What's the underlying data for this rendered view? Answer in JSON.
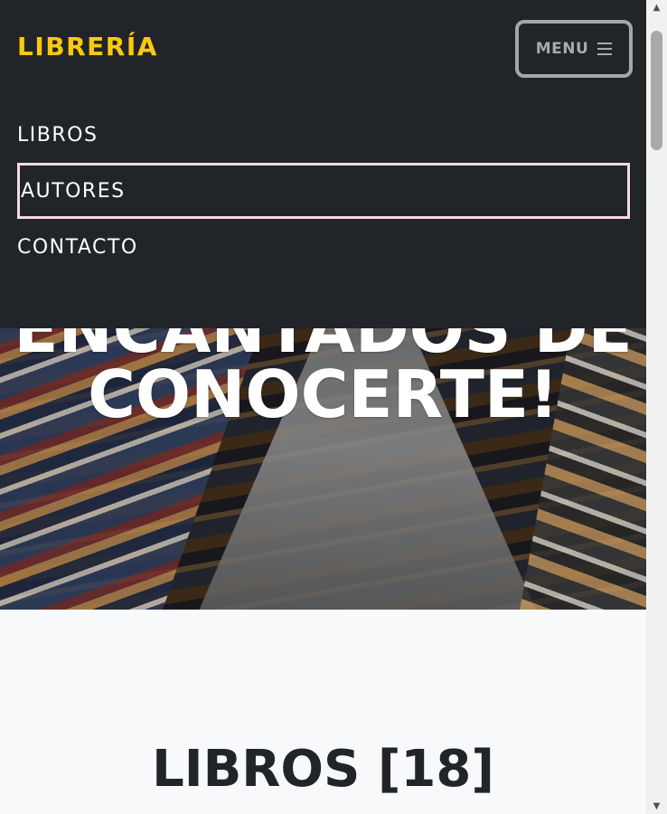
{
  "navbar": {
    "brand": "LIBRERÍA",
    "menu_label": "MENU",
    "links": [
      {
        "label": "LIBROS"
      },
      {
        "label": "AUTORES"
      },
      {
        "label": "CONTACTO"
      }
    ]
  },
  "hero": {
    "heading": "ENCANTADOS DE CONOCERTE!"
  },
  "books_section": {
    "title": "LIBROS [18]"
  },
  "colors": {
    "navbar_bg": "#212529",
    "brand": "#fec810",
    "focus_outline": "#f7d9dd",
    "section_bg": "#f8f9fa"
  }
}
